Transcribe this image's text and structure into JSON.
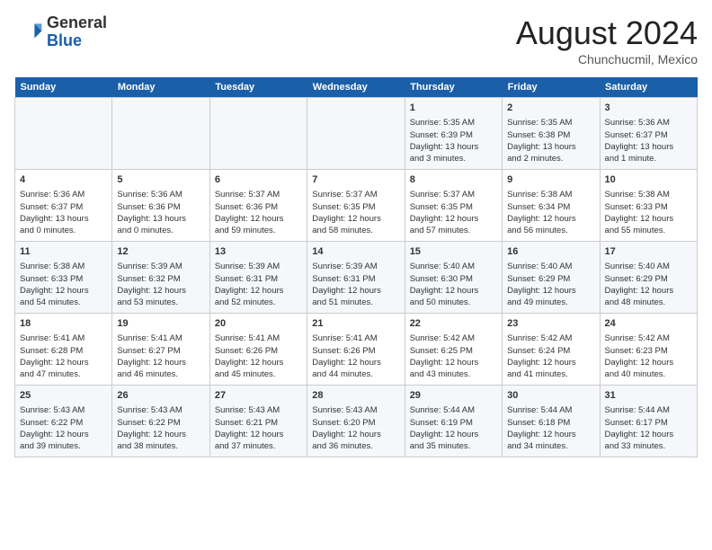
{
  "header": {
    "logo_line1": "General",
    "logo_line2": "Blue",
    "month_year": "August 2024",
    "location": "Chunchucmil, Mexico"
  },
  "days_of_week": [
    "Sunday",
    "Monday",
    "Tuesday",
    "Wednesday",
    "Thursday",
    "Friday",
    "Saturday"
  ],
  "weeks": [
    [
      {
        "day": "",
        "info": ""
      },
      {
        "day": "",
        "info": ""
      },
      {
        "day": "",
        "info": ""
      },
      {
        "day": "",
        "info": ""
      },
      {
        "day": "1",
        "info": "Sunrise: 5:35 AM\nSunset: 6:39 PM\nDaylight: 13 hours\nand 3 minutes."
      },
      {
        "day": "2",
        "info": "Sunrise: 5:35 AM\nSunset: 6:38 PM\nDaylight: 13 hours\nand 2 minutes."
      },
      {
        "day": "3",
        "info": "Sunrise: 5:36 AM\nSunset: 6:37 PM\nDaylight: 13 hours\nand 1 minute."
      }
    ],
    [
      {
        "day": "4",
        "info": "Sunrise: 5:36 AM\nSunset: 6:37 PM\nDaylight: 13 hours\nand 0 minutes."
      },
      {
        "day": "5",
        "info": "Sunrise: 5:36 AM\nSunset: 6:36 PM\nDaylight: 13 hours\nand 0 minutes."
      },
      {
        "day": "6",
        "info": "Sunrise: 5:37 AM\nSunset: 6:36 PM\nDaylight: 12 hours\nand 59 minutes."
      },
      {
        "day": "7",
        "info": "Sunrise: 5:37 AM\nSunset: 6:35 PM\nDaylight: 12 hours\nand 58 minutes."
      },
      {
        "day": "8",
        "info": "Sunrise: 5:37 AM\nSunset: 6:35 PM\nDaylight: 12 hours\nand 57 minutes."
      },
      {
        "day": "9",
        "info": "Sunrise: 5:38 AM\nSunset: 6:34 PM\nDaylight: 12 hours\nand 56 minutes."
      },
      {
        "day": "10",
        "info": "Sunrise: 5:38 AM\nSunset: 6:33 PM\nDaylight: 12 hours\nand 55 minutes."
      }
    ],
    [
      {
        "day": "11",
        "info": "Sunrise: 5:38 AM\nSunset: 6:33 PM\nDaylight: 12 hours\nand 54 minutes."
      },
      {
        "day": "12",
        "info": "Sunrise: 5:39 AM\nSunset: 6:32 PM\nDaylight: 12 hours\nand 53 minutes."
      },
      {
        "day": "13",
        "info": "Sunrise: 5:39 AM\nSunset: 6:31 PM\nDaylight: 12 hours\nand 52 minutes."
      },
      {
        "day": "14",
        "info": "Sunrise: 5:39 AM\nSunset: 6:31 PM\nDaylight: 12 hours\nand 51 minutes."
      },
      {
        "day": "15",
        "info": "Sunrise: 5:40 AM\nSunset: 6:30 PM\nDaylight: 12 hours\nand 50 minutes."
      },
      {
        "day": "16",
        "info": "Sunrise: 5:40 AM\nSunset: 6:29 PM\nDaylight: 12 hours\nand 49 minutes."
      },
      {
        "day": "17",
        "info": "Sunrise: 5:40 AM\nSunset: 6:29 PM\nDaylight: 12 hours\nand 48 minutes."
      }
    ],
    [
      {
        "day": "18",
        "info": "Sunrise: 5:41 AM\nSunset: 6:28 PM\nDaylight: 12 hours\nand 47 minutes."
      },
      {
        "day": "19",
        "info": "Sunrise: 5:41 AM\nSunset: 6:27 PM\nDaylight: 12 hours\nand 46 minutes."
      },
      {
        "day": "20",
        "info": "Sunrise: 5:41 AM\nSunset: 6:26 PM\nDaylight: 12 hours\nand 45 minutes."
      },
      {
        "day": "21",
        "info": "Sunrise: 5:41 AM\nSunset: 6:26 PM\nDaylight: 12 hours\nand 44 minutes."
      },
      {
        "day": "22",
        "info": "Sunrise: 5:42 AM\nSunset: 6:25 PM\nDaylight: 12 hours\nand 43 minutes."
      },
      {
        "day": "23",
        "info": "Sunrise: 5:42 AM\nSunset: 6:24 PM\nDaylight: 12 hours\nand 41 minutes."
      },
      {
        "day": "24",
        "info": "Sunrise: 5:42 AM\nSunset: 6:23 PM\nDaylight: 12 hours\nand 40 minutes."
      }
    ],
    [
      {
        "day": "25",
        "info": "Sunrise: 5:43 AM\nSunset: 6:22 PM\nDaylight: 12 hours\nand 39 minutes."
      },
      {
        "day": "26",
        "info": "Sunrise: 5:43 AM\nSunset: 6:22 PM\nDaylight: 12 hours\nand 38 minutes."
      },
      {
        "day": "27",
        "info": "Sunrise: 5:43 AM\nSunset: 6:21 PM\nDaylight: 12 hours\nand 37 minutes."
      },
      {
        "day": "28",
        "info": "Sunrise: 5:43 AM\nSunset: 6:20 PM\nDaylight: 12 hours\nand 36 minutes."
      },
      {
        "day": "29",
        "info": "Sunrise: 5:44 AM\nSunset: 6:19 PM\nDaylight: 12 hours\nand 35 minutes."
      },
      {
        "day": "30",
        "info": "Sunrise: 5:44 AM\nSunset: 6:18 PM\nDaylight: 12 hours\nand 34 minutes."
      },
      {
        "day": "31",
        "info": "Sunrise: 5:44 AM\nSunset: 6:17 PM\nDaylight: 12 hours\nand 33 minutes."
      }
    ]
  ]
}
